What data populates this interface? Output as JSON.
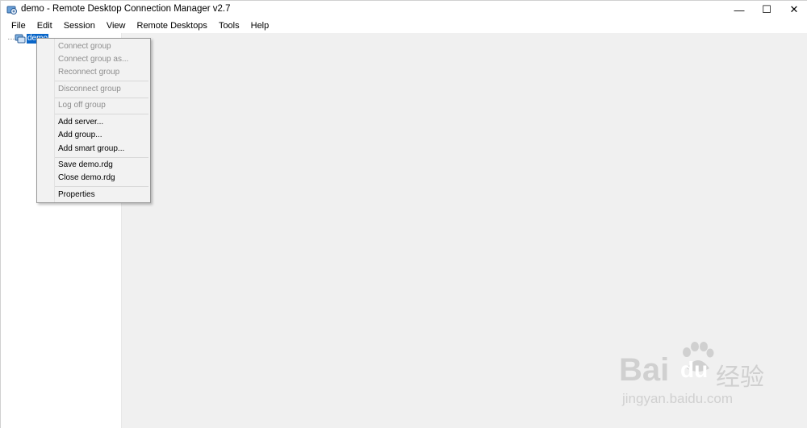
{
  "titlebar": {
    "title": "demo - Remote Desktop Connection Manager v2.7",
    "minimize_glyph": "—",
    "maximize_glyph": "☐",
    "close_glyph": "✕"
  },
  "menubar": {
    "items": [
      "File",
      "Edit",
      "Session",
      "View",
      "Remote Desktops",
      "Tools",
      "Help"
    ]
  },
  "tree": {
    "root_label": "demo"
  },
  "context_menu": {
    "items": [
      {
        "label": "Connect group",
        "enabled": false
      },
      {
        "label": "Connect group as...",
        "enabled": false
      },
      {
        "label": "Reconnect group",
        "enabled": false
      },
      {
        "label": "Disconnect group",
        "enabled": false
      },
      {
        "label": "Log off group",
        "enabled": false
      },
      {
        "label": "Add server...",
        "enabled": true
      },
      {
        "label": "Add group...",
        "enabled": true
      },
      {
        "label": "Add smart group...",
        "enabled": true
      },
      {
        "label": "Save demo.rdg",
        "enabled": true
      },
      {
        "label": "Close demo.rdg",
        "enabled": true
      },
      {
        "label": "Properties",
        "enabled": true
      }
    ]
  },
  "watermark": {
    "brand": "Bai",
    "brand2": "du",
    "brand_cn": "经验",
    "url": "jingyan.baidu.com"
  },
  "colors": {
    "selection": "#0a66c8",
    "main_background": "#f0f0f0",
    "menu_background": "#f2f2f2",
    "disabled_text": "#8d8d8d"
  },
  "icons": [
    "app-icon",
    "server-group-icon",
    "minimize-icon",
    "maximize-icon",
    "close-icon",
    "paw-icon"
  ]
}
